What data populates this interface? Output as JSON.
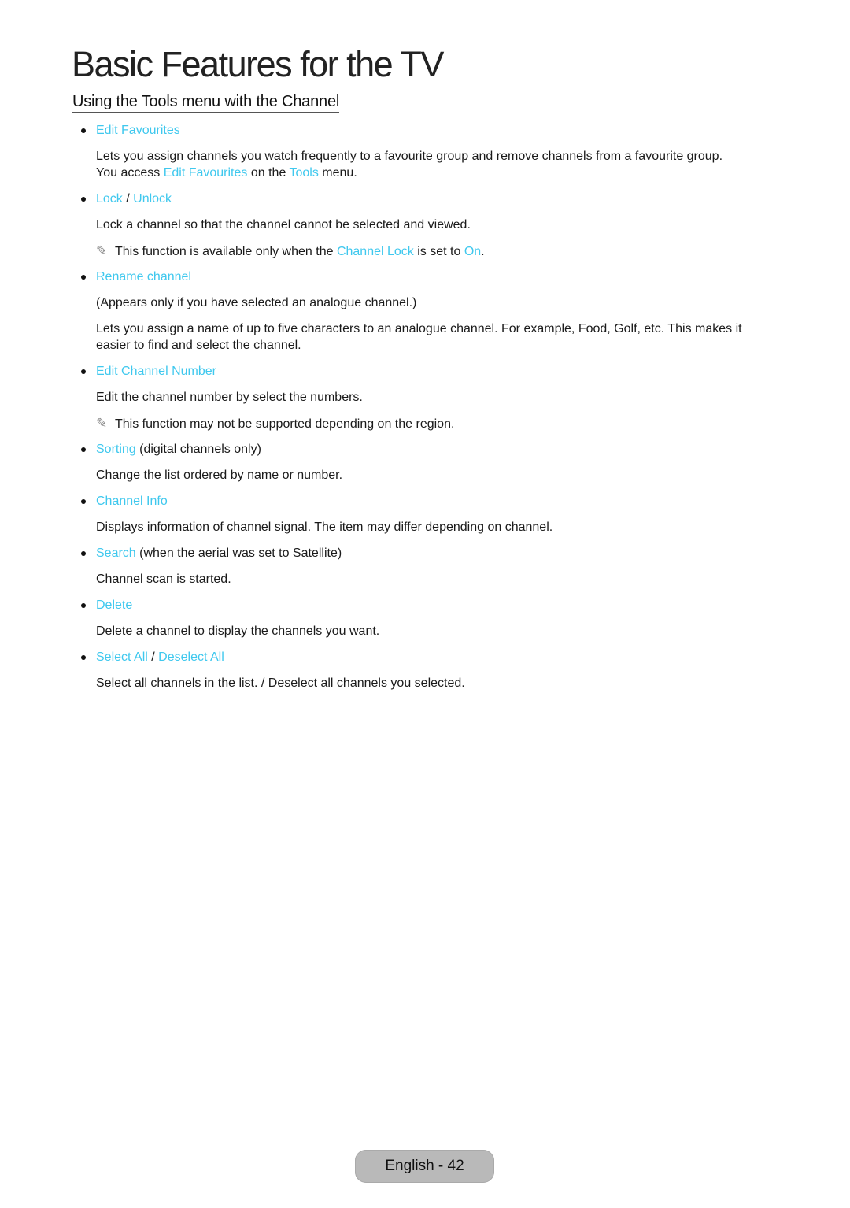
{
  "page": {
    "title": "Basic Features for the TV",
    "section_title": "Using the Tools menu with the Channel",
    "accent_color": "#3fc8ee"
  },
  "items": [
    {
      "heading": [
        "Edit Favourites"
      ],
      "desc1": "Lets you assign channels you watch frequently to a favourite group and remove channels from a favourite group.",
      "desc2_parts": [
        "You access ",
        "Edit Favourites",
        " on the ",
        "Tools",
        " menu."
      ]
    },
    {
      "heading": [
        "Lock",
        " / ",
        "Unlock"
      ],
      "desc": "Lock a channel so that the channel cannot be selected and viewed.",
      "note_parts": [
        "This function is available only when the ",
        "Channel Lock",
        " is set to ",
        "On",
        "."
      ]
    },
    {
      "heading": [
        "Rename channel"
      ],
      "desc1": "(Appears only if you have selected an analogue channel.)",
      "desc2": "Lets you assign a name of up to five characters to an analogue channel. For example, Food, Golf, etc. This makes it",
      "desc3": "easier to find and select the channel."
    },
    {
      "heading": [
        "Edit Channel Number"
      ],
      "desc": "Edit the channel number by select the numbers.",
      "note": "This function may not be supported depending on the region."
    },
    {
      "heading": [
        "Sorting",
        " (digital channels only)"
      ],
      "desc": "Change the list ordered by name or number."
    },
    {
      "heading": [
        "Channel Info"
      ],
      "desc": "Displays information of channel signal. The item may differ depending on channel."
    },
    {
      "heading": [
        "Search",
        " (when the aerial was set to Satellite)"
      ],
      "desc": "Channel scan is started."
    },
    {
      "heading": [
        "Delete"
      ],
      "desc": "Delete a channel to display the channels you want."
    },
    {
      "heading": [
        "Select All",
        " / ",
        "Deselect All"
      ],
      "desc": "Select all channels in the list. / Deselect all channels you selected."
    }
  ],
  "icons": {
    "note": "✎"
  },
  "footer": {
    "label": "English - 42"
  }
}
